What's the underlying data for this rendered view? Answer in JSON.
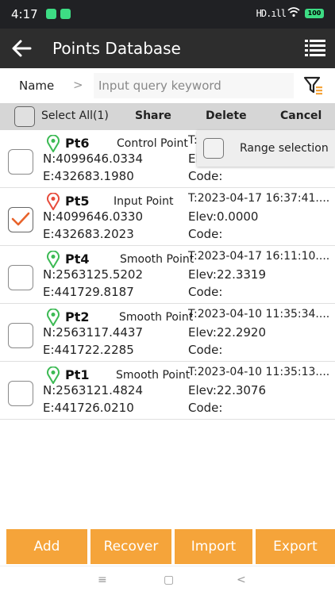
{
  "status_bar": {
    "time": "4:17",
    "signal": "HD.ıll",
    "battery": "100"
  },
  "app_bar": {
    "title": "Points Database",
    "back_icon": "arrow-left-icon",
    "menu_icon": "list-menu-icon"
  },
  "search": {
    "field": "Name",
    "separator": ">",
    "placeholder": "Input query keyword",
    "filter_icon": "filter-icon"
  },
  "toolbar": {
    "select_all": "Select All(1)",
    "share": "Share",
    "delete": "Delete",
    "cancel": "Cancel"
  },
  "range_selection": {
    "label": "Range selection",
    "checked": false
  },
  "points": [
    {
      "name": "Pt6",
      "type": "Control Point",
      "n": "N:4099646.0334",
      "e": "E:432683.1980",
      "time": "T:",
      "elev": "El",
      "code": "Code:",
      "checked": false,
      "pin_color": "#3cba54"
    },
    {
      "name": "Pt5",
      "type": "Input Point",
      "n": "N:4099646.0330",
      "e": "E:432683.2023",
      "time": "T:2023-04-17 16:37:41....",
      "elev": "Elev:0.0000",
      "code": "Code:",
      "checked": true,
      "pin_color": "#e74c3c"
    },
    {
      "name": "Pt4",
      "type": "Smooth Point",
      "n": "N:2563125.5202",
      "e": "E:441729.8187",
      "time": "T:2023-04-17 16:11:10....",
      "elev": "Elev:22.3319",
      "code": "Code:",
      "checked": false,
      "pin_color": "#3cba54"
    },
    {
      "name": "Pt2",
      "type": "Smooth Point",
      "n": "N:2563117.4437",
      "e": "E:441722.2285",
      "time": "T:2023-04-10 11:35:34....",
      "elev": "Elev:22.2920",
      "code": "Code:",
      "checked": false,
      "pin_color": "#3cba54"
    },
    {
      "name": "Pt1",
      "type": "Smooth Point",
      "n": "N:2563121.4824",
      "e": "E:441726.0210",
      "time": "T:2023-04-10 11:35:13....",
      "elev": "Elev:22.3076",
      "code": "Code:",
      "checked": false,
      "pin_color": "#3cba54"
    }
  ],
  "buttons": {
    "add": "Add",
    "recover": "Recover",
    "import": "Import",
    "export": "Export"
  },
  "nav": {
    "menu": "≡",
    "home": "▢",
    "back": "<"
  },
  "colors": {
    "accent": "#f5a43a",
    "appbar": "#2d2d2d",
    "check": "#e8632b"
  }
}
